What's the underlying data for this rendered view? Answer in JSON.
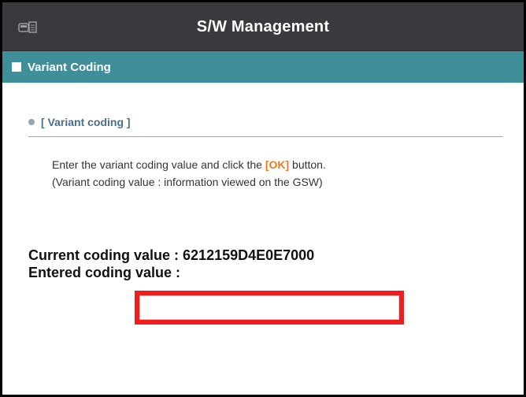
{
  "titlebar": {
    "title": "S/W Management",
    "icon": "vehicle-document-icon"
  },
  "section": {
    "label": "Variant Coding"
  },
  "subheading": {
    "label": "[ Variant coding ]"
  },
  "instruction": {
    "line1_prefix": "Enter the variant coding value and click the ",
    "ok_label": "[OK]",
    "line1_suffix": " button.",
    "line2": "(Variant coding value : information viewed on the GSW)"
  },
  "coding": {
    "current_label": "Current coding value : ",
    "current_value": "6212159D4E0E7000",
    "entered_label": "Entered coding value :"
  },
  "entry": {
    "value": ""
  },
  "colors": {
    "titlebar": "#3a3a3e",
    "section_header": "#3f8f9a",
    "accent_ok": "#ef7a1a",
    "highlight_box": "#ef1d1d"
  }
}
